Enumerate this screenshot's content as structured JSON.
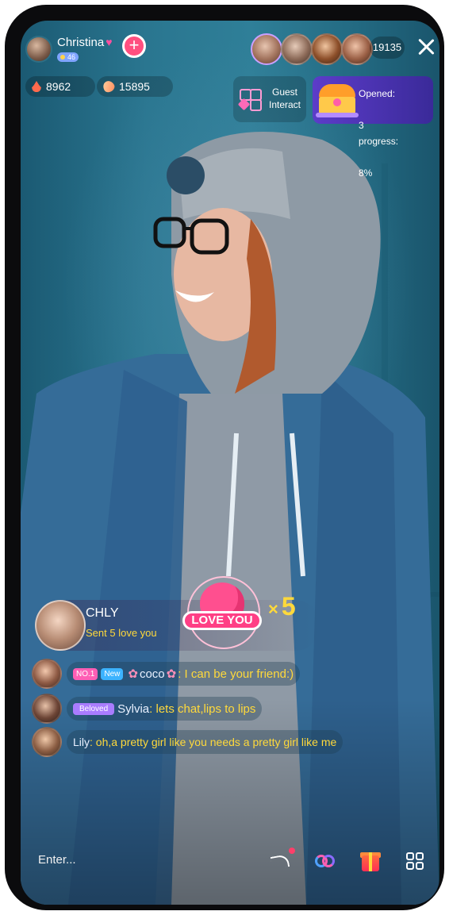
{
  "host": {
    "name": "Christina",
    "badge_level": "46",
    "follow_symbol": "+"
  },
  "viewer_count": "19135",
  "stats": {
    "fire": "8962",
    "gems": "15895"
  },
  "guest_interact": {
    "line1": "Guest",
    "line2": "Interact"
  },
  "treasure": {
    "opened_label": "Opened:",
    "opened_value": "3",
    "progress_label": "progress:",
    "progress_value": "8%"
  },
  "gift_announcement": {
    "sender": "CHLY",
    "text": "Sent 5 love you",
    "gift_label": "LOVE YOU",
    "multiplier_symbol": "×",
    "multiplier_value": "5"
  },
  "chat": [
    {
      "tags": [
        "NO.1",
        "New"
      ],
      "user": "coco",
      "message": ": I can be your friend:)"
    },
    {
      "tags": [
        "Beloved"
      ],
      "user": "Sylvia",
      "message": ": lets chat,lips to lips"
    },
    {
      "tags": [],
      "user": "Lily",
      "message": ": oh,a pretty girl like you needs a pretty girl like me"
    }
  ],
  "input": {
    "placeholder": "Enter..."
  },
  "icons": [
    "fire-icon",
    "gem-icon",
    "close-icon",
    "share-icon",
    "link-icon",
    "gift-icon",
    "more-grid-icon"
  ],
  "colors": {
    "accent_pink": "#ff4f8f",
    "message_yellow": "#ffd93b",
    "treasure_purple": "#5c3cc9"
  }
}
